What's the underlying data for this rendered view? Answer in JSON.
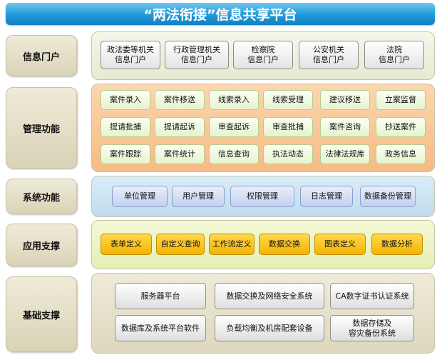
{
  "title": "“两法衔接”信息共享平台",
  "rows": [
    {
      "label": "信息门户",
      "items": [
        "政法委等机关\n信息门户",
        "行政管理机关\n信息门户",
        "检察院\n信息门户",
        "公安机关\n信息门户",
        "法院\n信息门户"
      ]
    },
    {
      "label": "管理功能",
      "items": [
        "案件录入",
        "案件移送",
        "线索录入",
        "线索受理",
        "建议移送",
        "立案监督",
        "提请批捕",
        "提请起诉",
        "审查起诉",
        "审查批捕",
        "案件咨询",
        "抄送案件",
        "案件跟踪",
        "案件统计",
        "信息查询",
        "执法动态",
        "法律法规库",
        "政务信息"
      ]
    },
    {
      "label": "系统功能",
      "items": [
        "单位管理",
        "用户管理",
        "权限管理",
        "日志管理",
        "数据备份管理"
      ]
    },
    {
      "label": "应用支撑",
      "items": [
        "表单定义",
        "自定义查询",
        "工作流定义",
        "数据交换",
        "图表定义",
        "数据分析"
      ]
    },
    {
      "label": "基础支撑",
      "items": [
        "服务器平台",
        "数据交换及网络安全系统",
        "CA数字证书认证系统",
        "数据库及系统平台软件",
        "负载均衡及机房配套设备",
        "数据存储及\n容灾备份系统"
      ]
    }
  ],
  "colors": {
    "title_bg": "#1f9ad9",
    "portal_panel": "#eef1df",
    "management_panel": "#f9c89a",
    "system_panel": "#cde5f3",
    "support_panel": "#eef6c8",
    "infra_panel": "#e7e2cc"
  }
}
